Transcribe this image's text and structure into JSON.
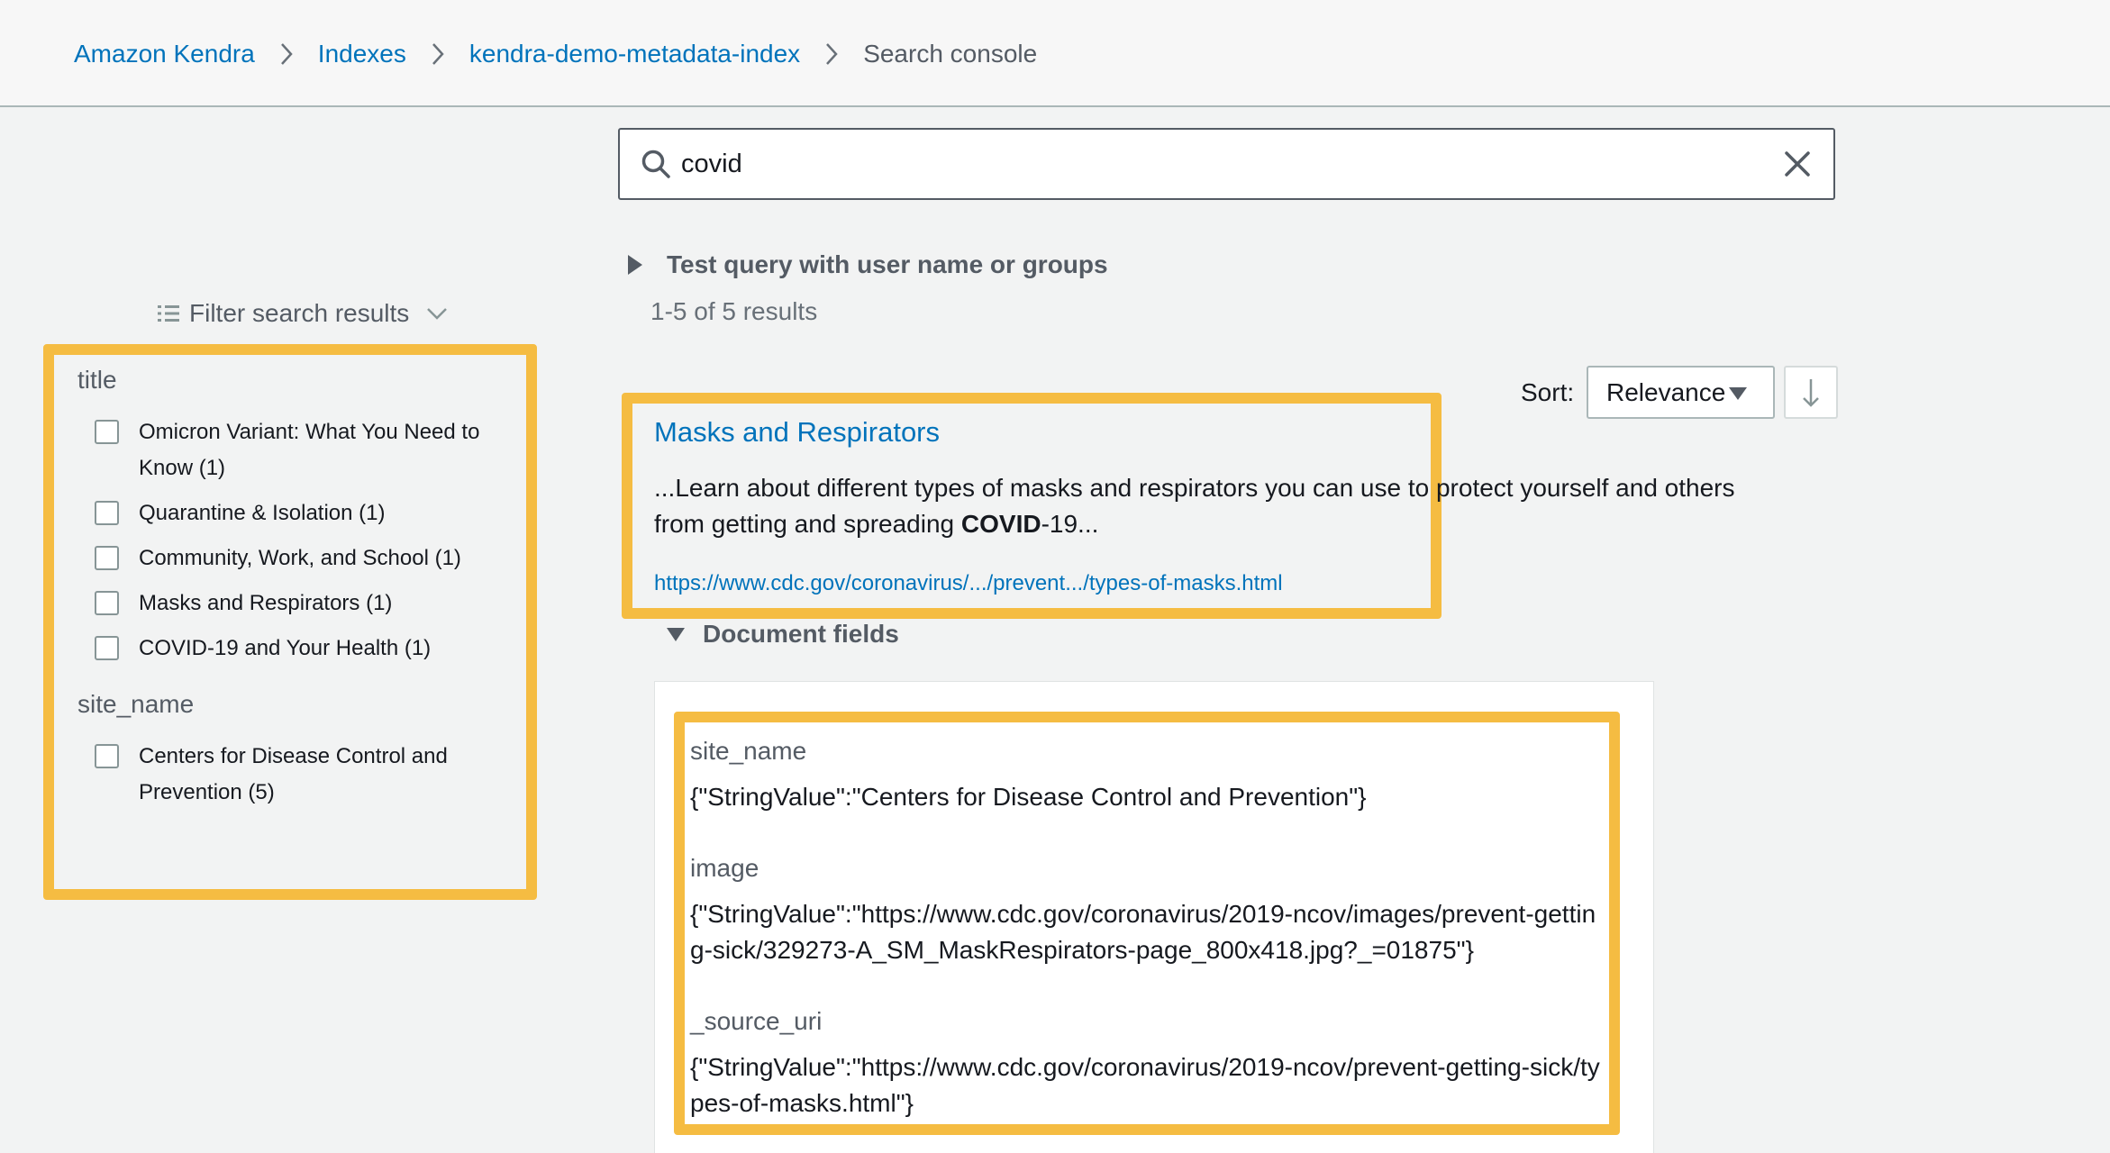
{
  "breadcrumb": {
    "items": [
      "Amazon Kendra",
      "Indexes",
      "kendra-demo-metadata-index"
    ],
    "current": "Search console"
  },
  "search": {
    "value": "covid",
    "icon": "search-icon",
    "clear_icon": "close-icon"
  },
  "test_query_label": "Test query with user name or groups",
  "results_count": "1-5 of 5 results",
  "filter": {
    "header": "Filter search results",
    "facets": [
      {
        "name": "title",
        "items": [
          "Omicron Variant: What You Need to Know (1)",
          "Quarantine & Isolation (1)",
          "Community, Work, and School (1)",
          "Masks and Respirators (1)",
          "COVID-19 and Your Health (1)"
        ]
      },
      {
        "name": "site_name",
        "items": [
          "Centers for Disease Control and Prevention (5)"
        ]
      }
    ]
  },
  "sort": {
    "label": "Sort:",
    "selected": "Relevance"
  },
  "result": {
    "title": "Masks and Respirators",
    "excerpt_before": "...Learn about different types of masks and respirators you can use to protect yourself and others from getting and spreading ",
    "excerpt_bold": "COVID",
    "excerpt_after": "-19...",
    "url": "https://www.cdc.gov/coronavirus/.../prevent.../types-of-masks.html"
  },
  "document_fields": {
    "toggle_label": "Document fields",
    "fields": [
      {
        "name": "site_name",
        "value": "{\"StringValue\":\"Centers for Disease Control and Prevention\"}"
      },
      {
        "name": "image",
        "value": "{\"StringValue\":\"https://www.cdc.gov/coronavirus/2019-ncov/images/prevent-getting-sick/329273-A_SM_MaskRespirators-page_800x418.jpg?_=01875\"}"
      },
      {
        "name": "_source_uri",
        "value": "{\"StringValue\":\"https://www.cdc.gov/coronavirus/2019-ncov/prevent-getting-sick/types-of-masks.html\"}"
      }
    ]
  },
  "colors": {
    "link": "#0073bb",
    "highlight": "#f5bc42",
    "text": "#16191f",
    "muted": "#545b64"
  }
}
